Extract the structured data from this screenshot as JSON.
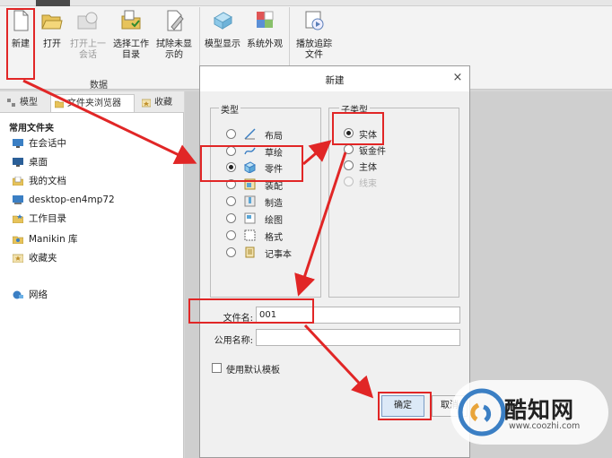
{
  "ribbon": {
    "buttons": [
      {
        "label": "新建",
        "icon": "new-file-icon"
      },
      {
        "label": "打开",
        "icon": "open-folder-icon"
      },
      {
        "label": "打开上一会话",
        "icon": "open-last-session-icon"
      },
      {
        "label": "选择工作目录",
        "icon": "select-working-dir-icon"
      },
      {
        "label": "拭除未显示的",
        "icon": "erase-not-displayed-icon"
      },
      {
        "label": "模型显示",
        "icon": "model-display-icon"
      },
      {
        "label": "系统外观",
        "icon": "system-appearance-icon"
      },
      {
        "label": "播放追踪文件",
        "icon": "play-trail-file-icon"
      }
    ],
    "group_label": "数据"
  },
  "left_panel": {
    "tabs": [
      "模型",
      "文件夹浏览器",
      "收藏"
    ],
    "folder_header": "常用文件夹",
    "items": [
      {
        "label": "在会话中",
        "icon": "in-session-icon"
      },
      {
        "label": "桌面",
        "icon": "desktop-icon"
      },
      {
        "label": "我的文档",
        "icon": "my-documents-icon"
      },
      {
        "label": "desktop-en4mp72",
        "icon": "computer-icon"
      },
      {
        "label": "工作目录",
        "icon": "working-directory-icon"
      },
      {
        "label": "Manikin 库",
        "icon": "manikin-library-icon"
      },
      {
        "label": "收藏夹",
        "icon": "favorites-icon"
      },
      {
        "label": "网络",
        "icon": "network-icon"
      }
    ]
  },
  "dialog": {
    "title": "新建",
    "type_group_label": "类型",
    "types": [
      {
        "label": "布局",
        "selected": false,
        "icon": "layout-icon"
      },
      {
        "label": "草绘",
        "selected": false,
        "icon": "sketch-icon"
      },
      {
        "label": "零件",
        "selected": true,
        "icon": "part-icon"
      },
      {
        "label": "装配",
        "selected": false,
        "icon": "assembly-icon"
      },
      {
        "label": "制造",
        "selected": false,
        "icon": "manufacturing-icon"
      },
      {
        "label": "绘图",
        "selected": false,
        "icon": "drawing-icon"
      },
      {
        "label": "格式",
        "selected": false,
        "icon": "format-icon"
      },
      {
        "label": "记事本",
        "selected": false,
        "icon": "notebook-icon"
      }
    ],
    "subtype_group_label": "子类型",
    "subtypes": [
      {
        "label": "实体",
        "selected": true,
        "disabled": false
      },
      {
        "label": "钣金件",
        "selected": false,
        "disabled": false
      },
      {
        "label": "主体",
        "selected": false,
        "disabled": false
      },
      {
        "label": "线束",
        "selected": false,
        "disabled": true
      }
    ],
    "filename_label": "文件名:",
    "filename_value": "001",
    "common_name_label": "公用名称:",
    "common_name_value": "",
    "use_default_template_label": "使用默认模板",
    "use_default_template_checked": false,
    "ok_label": "确定",
    "cancel_label": "取消"
  },
  "watermark": {
    "brand": "酷知网",
    "url": "www.coozhi.com"
  },
  "colors": {
    "annotation_red": "#e12626",
    "ok_button_bg": "#dce9f7",
    "ribbon_bg": "#f3f3f3"
  }
}
